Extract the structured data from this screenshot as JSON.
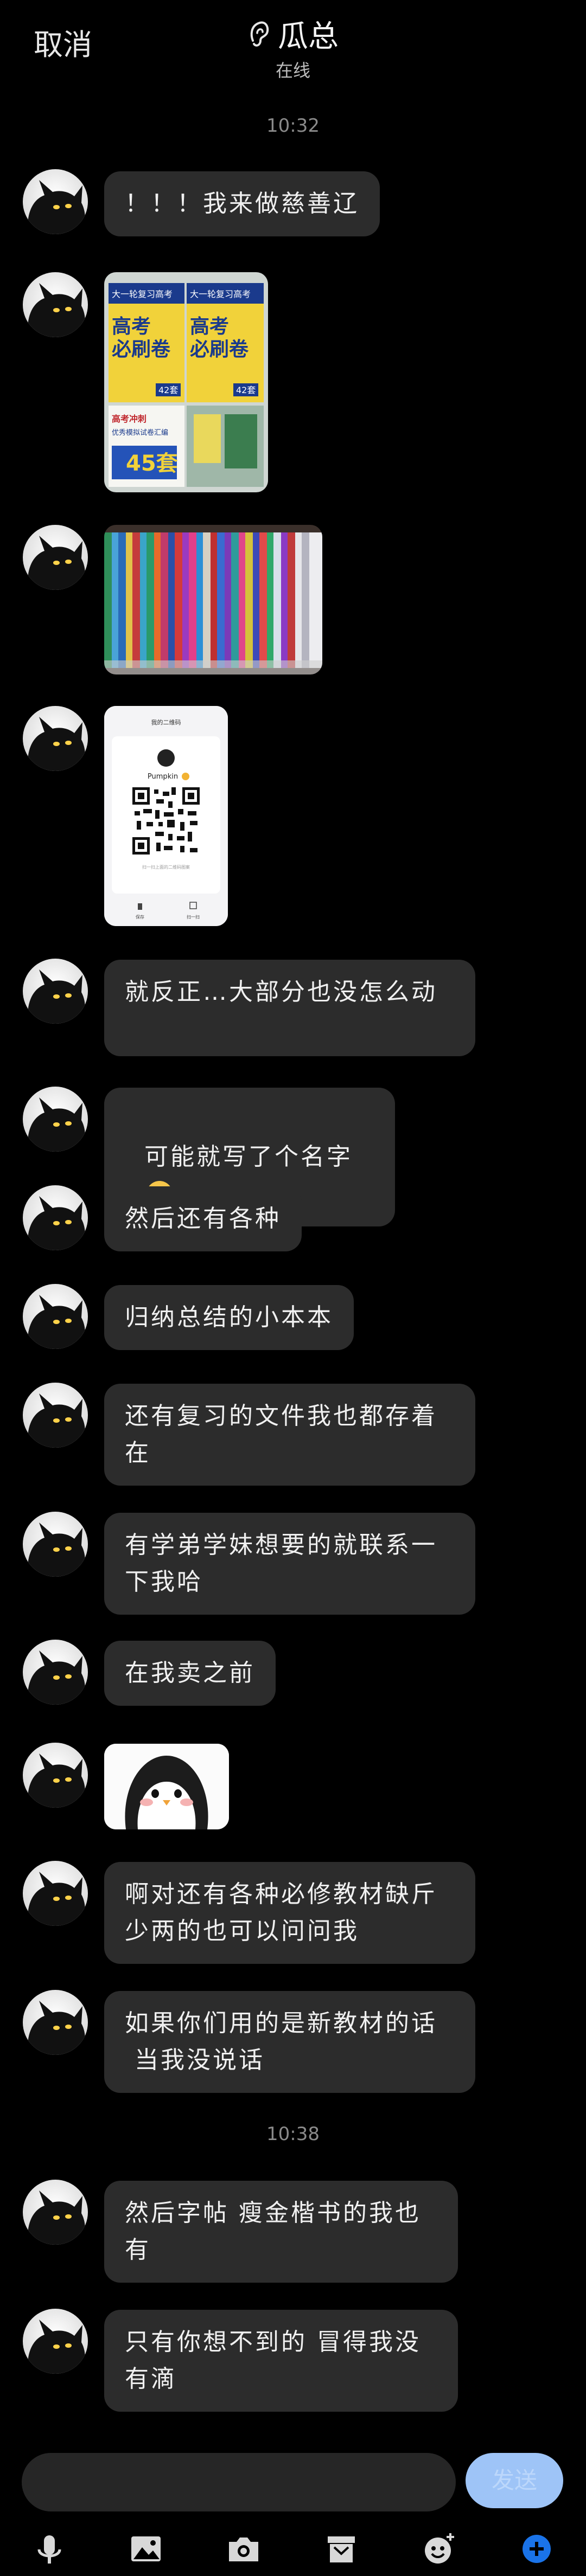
{
  "header": {
    "cancel_label": "取消",
    "title": "瓜总",
    "status": "在线"
  },
  "times": [
    "10:32",
    "10:38"
  ],
  "messages": {
    "m1": "！！！我来做慈善辽",
    "m5": "就反正…大部分也没怎么动",
    "m6": "可能就写了个名字",
    "m7": "然后还有各种",
    "m8": "归纳总结的小本本",
    "m9": "还有复习的文件我也都存着\n在",
    "m10": "有学弟学妹想要的就联系一\n下我哈",
    "m11": "在我卖之前",
    "m13": "啊对还有各种必修教材缺斤\n少两的也可以问问我",
    "m14": "如果你们用的是新教材的话\n 当我没说话",
    "m15": "然后字帖 瘦金楷书的我也\n有",
    "m16": "只有你想不到的 冒得我没\n有滴"
  },
  "photo1": {
    "banner_top": "大一轮复习高考",
    "brand_line1": "高考",
    "brand_line2": "必刷卷",
    "badge": "42套",
    "bottom_text": "高考冲刺",
    "bottom_sub": "优秀模拟试卷汇编",
    "num": "45套"
  },
  "qr_card": {
    "title": "我的二维码",
    "name": "Pumpkin",
    "hint": "扫一扫上面的二维码图案",
    "save": "保存",
    "scan": "扫一扫"
  },
  "composer": {
    "send_label": "发送"
  },
  "icons": [
    "mic-icon",
    "image-icon",
    "camera-icon",
    "box-icon",
    "emoji-icon",
    "plus-icon"
  ],
  "colors": {
    "accent": "#1a73e8",
    "bubble": "#2c2c2c",
    "send": "#9ec4f7"
  }
}
